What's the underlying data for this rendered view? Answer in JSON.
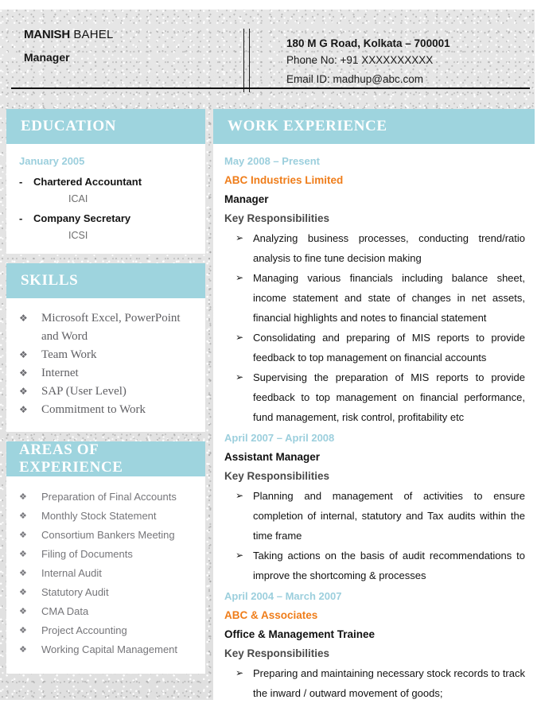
{
  "theme": {
    "bar_color": "#9ed4de",
    "date_color": "#9ccfdd",
    "company_color": "#ef7d1a",
    "paper_color": "#e2e2e2"
  },
  "header": {
    "first_name": "MANISH",
    "last_name": " BAHEL",
    "role": "Manager",
    "address": "180 M G Road, Kolkata – 700001",
    "phone": "Phone No: +91 XXXXXXXXXX",
    "email": "Email ID: madhup@abc.com"
  },
  "sections": {
    "education": {
      "title": "EDUCATION",
      "date": "January 2005",
      "items": [
        {
          "dash": "-",
          "degree": "Chartered Accountant",
          "institute": "ICAI"
        },
        {
          "dash": "-",
          "degree": "Company Secretary",
          "institute": "ICSI"
        }
      ]
    },
    "skills": {
      "title": "SKILLS",
      "bullet": "❖",
      "items": [
        "Microsoft Excel, PowerPoint and Word",
        "Team Work",
        "Internet",
        "SAP (User Level)",
        "Commitment to Work"
      ]
    },
    "areas": {
      "title": "AREAS OF EXPERIENCE",
      "bullet": "❖",
      "items": [
        "Preparation of Final Accounts",
        "Monthly Stock Statement",
        "Consortium Bankers Meeting",
        "Filing of Documents",
        "Internal Audit",
        "Statutory Audit",
        "CMA Data",
        "Project Accounting",
        "Working Capital Management"
      ]
    },
    "work": {
      "title": "WORK EXPERIENCE",
      "bullet": "➢",
      "key_responsibilities_label": "Key Responsibilities",
      "jobs": [
        {
          "date": "May 2008 – Present",
          "company": "ABC Industries Limited",
          "position": "Manager",
          "responsibilities": [
            "Analyzing business processes, conducting trend/ratio analysis to fine tune decision making",
            "Managing various financials including balance sheet, income statement and state of changes in net assets, financial highlights and notes to financial statement",
            "Consolidating and preparing of MIS reports to provide feedback to top management on financial accounts",
            "Supervising the preparation of MIS reports to provide feedback to top management on financial performance, fund management, risk control, profitability etc"
          ]
        },
        {
          "date": "April 2007 – April 2008",
          "company": "",
          "position": "Assistant Manager",
          "responsibilities": [
            "Planning and management of activities to ensure completion of internal, statutory and Tax audits within the time frame",
            "Taking actions on the basis of audit recommendations to improve the shortcoming & processes"
          ]
        },
        {
          "date": "April 2004 – March 2007",
          "company": "ABC & Associates",
          "position": "Office & Management Trainee",
          "responsibilities": [
            "Preparing and maintaining necessary stock records to track the inward / outward movement of goods;"
          ]
        }
      ]
    }
  }
}
